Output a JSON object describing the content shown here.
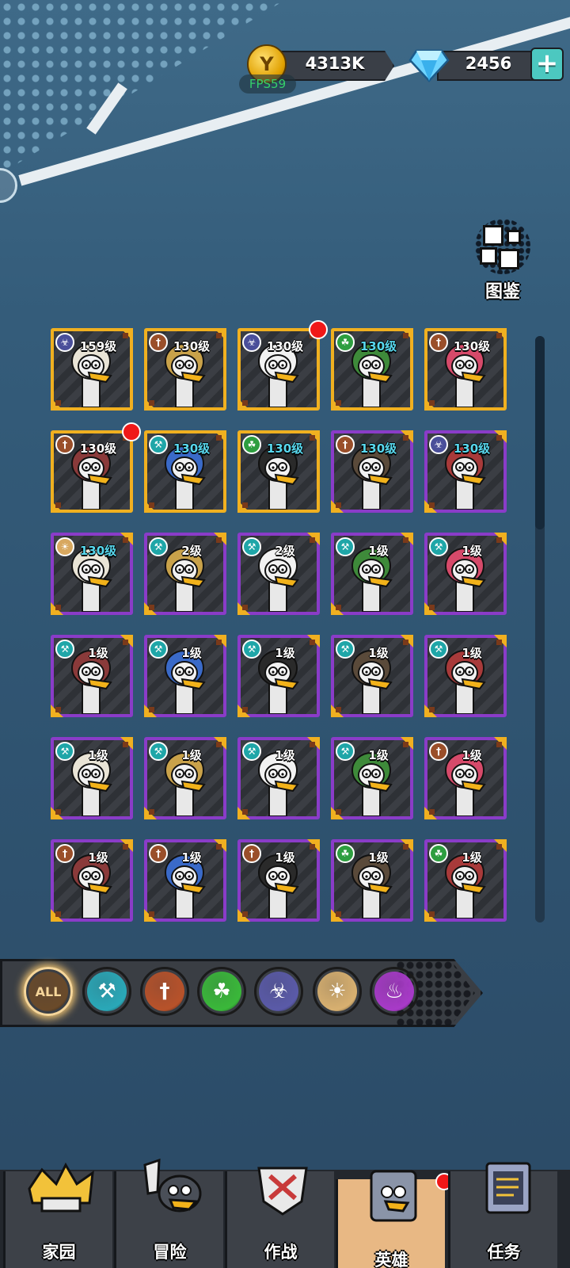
{
  "currency": {
    "coins": "4313K",
    "gems": "2456",
    "fps": "FPS59"
  },
  "codex": {
    "label": "图鉴"
  },
  "heroes": [
    {
      "level": "159级",
      "level_color": "white",
      "faction": "biohazard",
      "rarity": "gold",
      "alert": false
    },
    {
      "level": "130级",
      "level_color": "white",
      "faction": "dagger",
      "rarity": "gold",
      "alert": false
    },
    {
      "level": "130级",
      "level_color": "white",
      "faction": "biohazard",
      "rarity": "gold",
      "alert": true
    },
    {
      "level": "130级",
      "level_color": "cyan",
      "faction": "leaf",
      "rarity": "gold",
      "alert": false
    },
    {
      "level": "130级",
      "level_color": "white",
      "faction": "dagger",
      "rarity": "gold",
      "alert": false
    },
    {
      "level": "130级",
      "level_color": "white",
      "faction": "dagger",
      "rarity": "gold",
      "alert": true
    },
    {
      "level": "130级",
      "level_color": "cyan",
      "faction": "wrench",
      "rarity": "gold",
      "alert": false
    },
    {
      "level": "130级",
      "level_color": "cyan",
      "faction": "leaf",
      "rarity": "gold",
      "alert": false
    },
    {
      "level": "130级",
      "level_color": "cyan",
      "faction": "dagger",
      "rarity": "purple",
      "alert": false
    },
    {
      "level": "130级",
      "level_color": "cyan",
      "faction": "biohazard",
      "rarity": "purple",
      "alert": false
    },
    {
      "level": "130级",
      "level_color": "cyan",
      "faction": "sun",
      "rarity": "purple",
      "alert": false
    },
    {
      "level": "2级",
      "level_color": "white",
      "faction": "wrench",
      "rarity": "purple",
      "alert": false
    },
    {
      "level": "2级",
      "level_color": "white",
      "faction": "wrench",
      "rarity": "purple",
      "alert": false
    },
    {
      "level": "1级",
      "level_color": "white",
      "faction": "wrench",
      "rarity": "purple",
      "alert": false
    },
    {
      "level": "1级",
      "level_color": "white",
      "faction": "wrench",
      "rarity": "purple",
      "alert": false
    },
    {
      "level": "1级",
      "level_color": "white",
      "faction": "wrench",
      "rarity": "purple",
      "alert": false
    },
    {
      "level": "1级",
      "level_color": "white",
      "faction": "wrench",
      "rarity": "purple",
      "alert": false
    },
    {
      "level": "1级",
      "level_color": "white",
      "faction": "wrench",
      "rarity": "purple",
      "alert": false
    },
    {
      "level": "1级",
      "level_color": "white",
      "faction": "wrench",
      "rarity": "purple",
      "alert": false
    },
    {
      "level": "1级",
      "level_color": "white",
      "faction": "wrench",
      "rarity": "purple",
      "alert": false
    },
    {
      "level": "1级",
      "level_color": "white",
      "faction": "wrench",
      "rarity": "purple",
      "alert": false
    },
    {
      "level": "1级",
      "level_color": "white",
      "faction": "wrench",
      "rarity": "purple",
      "alert": false
    },
    {
      "level": "1级",
      "level_color": "white",
      "faction": "wrench",
      "rarity": "purple",
      "alert": false
    },
    {
      "level": "1级",
      "level_color": "white",
      "faction": "wrench",
      "rarity": "purple",
      "alert": false
    },
    {
      "level": "1级",
      "level_color": "white",
      "faction": "dagger",
      "rarity": "purple",
      "alert": false
    },
    {
      "level": "1级",
      "level_color": "white",
      "faction": "dagger",
      "rarity": "purple",
      "alert": false
    },
    {
      "level": "1级",
      "level_color": "white",
      "faction": "dagger",
      "rarity": "purple",
      "alert": false
    },
    {
      "level": "1级",
      "level_color": "white",
      "faction": "dagger",
      "rarity": "purple",
      "alert": false
    },
    {
      "level": "1级",
      "level_color": "white",
      "faction": "leaf",
      "rarity": "purple",
      "alert": false
    },
    {
      "level": "1级",
      "level_color": "white",
      "faction": "leaf",
      "rarity": "purple",
      "alert": false
    }
  ],
  "filters": [
    {
      "name": "all",
      "label": "ALL",
      "color": "#6a4a2a",
      "active": true
    },
    {
      "name": "wrench",
      "label": "",
      "color": "#2aa8b8",
      "active": false
    },
    {
      "name": "dagger",
      "label": "",
      "color": "#b8522a",
      "active": false
    },
    {
      "name": "leaf",
      "label": "",
      "color": "#3ab83a",
      "active": false
    },
    {
      "name": "biohazard",
      "label": "",
      "color": "#5a5aa8",
      "active": false
    },
    {
      "name": "sun",
      "label": "",
      "color": "#d8b070",
      "active": false
    },
    {
      "name": "flame",
      "label": "",
      "color": "#a83ac8",
      "active": false
    }
  ],
  "nav": [
    {
      "label": "家园",
      "icon": "home-icon",
      "active": false,
      "alert": false
    },
    {
      "label": "冒险",
      "icon": "adventure-icon",
      "active": false,
      "alert": false
    },
    {
      "label": "作战",
      "icon": "battle-icon",
      "active": false,
      "alert": false
    },
    {
      "label": "英雄",
      "icon": "hero-book-icon",
      "active": true,
      "alert": true
    },
    {
      "label": "任务",
      "icon": "quest-scroll-icon",
      "active": false,
      "alert": false
    }
  ],
  "colors": {
    "faction_wrench": "#1fa6a8",
    "faction_dagger": "#9a4f2a",
    "faction_leaf": "#2e9e40",
    "faction_biohazard": "#4a4f9a",
    "faction_sun": "#d8a860",
    "gold_frame": "#f0b020",
    "purple_frame": "#8a3cc8"
  }
}
